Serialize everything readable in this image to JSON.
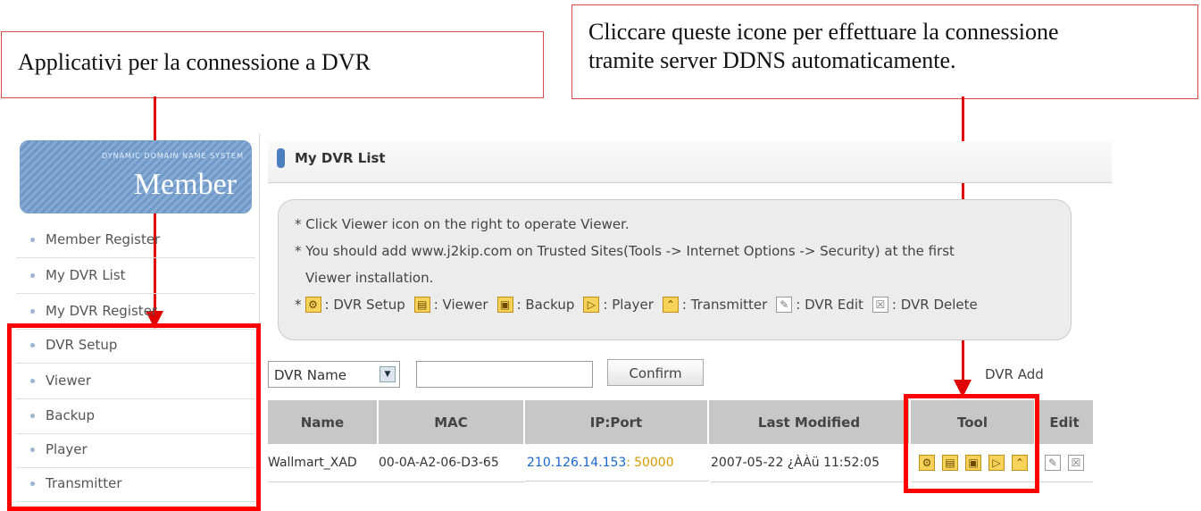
{
  "callouts": {
    "left": "Applicativi per la connessione a DVR",
    "right_line1": "Cliccare queste icone per effettuare la connessione",
    "right_line2": "tramite server DDNS automaticamente."
  },
  "sidebar": {
    "subtitle": "DYNAMIC DOMAIN NAME SYSTEM",
    "title": "Member",
    "items": [
      {
        "label": "Member Register"
      },
      {
        "label": "My DVR List"
      },
      {
        "label": "My DVR Register"
      },
      {
        "label": "DVR Setup"
      },
      {
        "label": "Viewer"
      },
      {
        "label": "Backup"
      },
      {
        "label": "Player"
      },
      {
        "label": "Transmitter"
      }
    ]
  },
  "header": {
    "title": "My DVR List"
  },
  "info": {
    "line1": "* Click Viewer icon on the right to operate Viewer.",
    "line2": "* You should add www.j2kip.com on Trusted Sites(Tools -> Internet Options -> Security) at the first",
    "line3": "Viewer installation.",
    "legend_prefix": "*",
    "legend": [
      "DVR Setup",
      "Viewer",
      "Backup",
      "Player",
      "Transmitter",
      "DVR Edit",
      "DVR Delete"
    ]
  },
  "search": {
    "select_value": "DVR Name",
    "input_value": "",
    "confirm_label": "Confirm",
    "add_label": "DVR Add"
  },
  "table": {
    "columns": [
      "Name",
      "MAC",
      "IP:Port",
      "Last Modified",
      "Tool",
      "Edit"
    ],
    "rows": [
      {
        "name": "Wallmart_XAD",
        "mac": "00-0A-A2-06-D3-65",
        "ip": "210.126.14.153",
        "port_sep": ":",
        "port": "50000",
        "modified": "2007-05-22 ¿ÀÀü 11:52:05"
      }
    ]
  },
  "icons": {
    "tool": [
      "gear-icon",
      "viewer-icon",
      "backup-icon",
      "play-icon",
      "transmitter-icon"
    ],
    "edit": [
      "edit-icon",
      "delete-icon"
    ]
  },
  "colors": {
    "highlight": "#ff0000",
    "accent": "#4c7ec0",
    "ip": "#1a66cc",
    "port": "#d49a00"
  }
}
